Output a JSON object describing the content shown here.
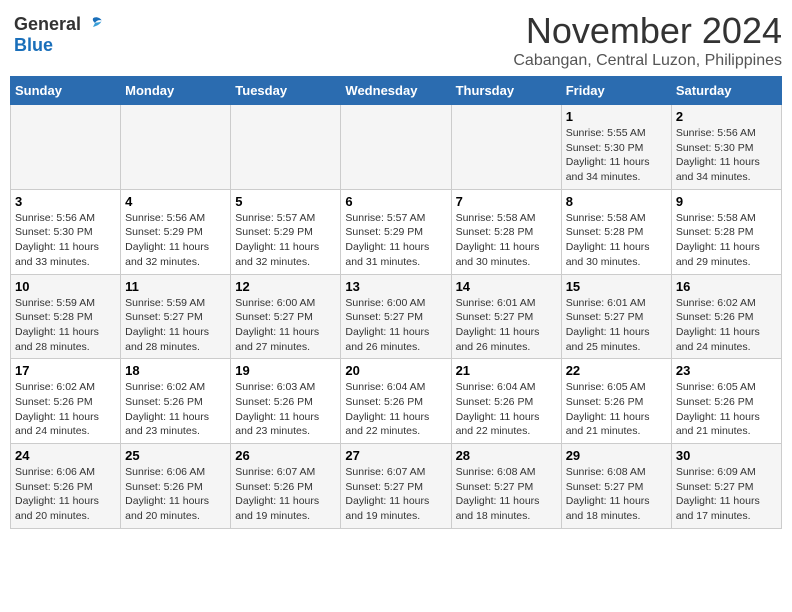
{
  "logo": {
    "general": "General",
    "blue": "Blue"
  },
  "title": "November 2024",
  "location": "Cabangan, Central Luzon, Philippines",
  "days_header": [
    "Sunday",
    "Monday",
    "Tuesday",
    "Wednesday",
    "Thursday",
    "Friday",
    "Saturday"
  ],
  "weeks": [
    [
      {
        "day": "",
        "info": ""
      },
      {
        "day": "",
        "info": ""
      },
      {
        "day": "",
        "info": ""
      },
      {
        "day": "",
        "info": ""
      },
      {
        "day": "",
        "info": ""
      },
      {
        "day": "1",
        "info": "Sunrise: 5:55 AM\nSunset: 5:30 PM\nDaylight: 11 hours and 34 minutes."
      },
      {
        "day": "2",
        "info": "Sunrise: 5:56 AM\nSunset: 5:30 PM\nDaylight: 11 hours and 34 minutes."
      }
    ],
    [
      {
        "day": "3",
        "info": "Sunrise: 5:56 AM\nSunset: 5:30 PM\nDaylight: 11 hours and 33 minutes."
      },
      {
        "day": "4",
        "info": "Sunrise: 5:56 AM\nSunset: 5:29 PM\nDaylight: 11 hours and 32 minutes."
      },
      {
        "day": "5",
        "info": "Sunrise: 5:57 AM\nSunset: 5:29 PM\nDaylight: 11 hours and 32 minutes."
      },
      {
        "day": "6",
        "info": "Sunrise: 5:57 AM\nSunset: 5:29 PM\nDaylight: 11 hours and 31 minutes."
      },
      {
        "day": "7",
        "info": "Sunrise: 5:58 AM\nSunset: 5:28 PM\nDaylight: 11 hours and 30 minutes."
      },
      {
        "day": "8",
        "info": "Sunrise: 5:58 AM\nSunset: 5:28 PM\nDaylight: 11 hours and 30 minutes."
      },
      {
        "day": "9",
        "info": "Sunrise: 5:58 AM\nSunset: 5:28 PM\nDaylight: 11 hours and 29 minutes."
      }
    ],
    [
      {
        "day": "10",
        "info": "Sunrise: 5:59 AM\nSunset: 5:28 PM\nDaylight: 11 hours and 28 minutes."
      },
      {
        "day": "11",
        "info": "Sunrise: 5:59 AM\nSunset: 5:27 PM\nDaylight: 11 hours and 28 minutes."
      },
      {
        "day": "12",
        "info": "Sunrise: 6:00 AM\nSunset: 5:27 PM\nDaylight: 11 hours and 27 minutes."
      },
      {
        "day": "13",
        "info": "Sunrise: 6:00 AM\nSunset: 5:27 PM\nDaylight: 11 hours and 26 minutes."
      },
      {
        "day": "14",
        "info": "Sunrise: 6:01 AM\nSunset: 5:27 PM\nDaylight: 11 hours and 26 minutes."
      },
      {
        "day": "15",
        "info": "Sunrise: 6:01 AM\nSunset: 5:27 PM\nDaylight: 11 hours and 25 minutes."
      },
      {
        "day": "16",
        "info": "Sunrise: 6:02 AM\nSunset: 5:26 PM\nDaylight: 11 hours and 24 minutes."
      }
    ],
    [
      {
        "day": "17",
        "info": "Sunrise: 6:02 AM\nSunset: 5:26 PM\nDaylight: 11 hours and 24 minutes."
      },
      {
        "day": "18",
        "info": "Sunrise: 6:02 AM\nSunset: 5:26 PM\nDaylight: 11 hours and 23 minutes."
      },
      {
        "day": "19",
        "info": "Sunrise: 6:03 AM\nSunset: 5:26 PM\nDaylight: 11 hours and 23 minutes."
      },
      {
        "day": "20",
        "info": "Sunrise: 6:04 AM\nSunset: 5:26 PM\nDaylight: 11 hours and 22 minutes."
      },
      {
        "day": "21",
        "info": "Sunrise: 6:04 AM\nSunset: 5:26 PM\nDaylight: 11 hours and 22 minutes."
      },
      {
        "day": "22",
        "info": "Sunrise: 6:05 AM\nSunset: 5:26 PM\nDaylight: 11 hours and 21 minutes."
      },
      {
        "day": "23",
        "info": "Sunrise: 6:05 AM\nSunset: 5:26 PM\nDaylight: 11 hours and 21 minutes."
      }
    ],
    [
      {
        "day": "24",
        "info": "Sunrise: 6:06 AM\nSunset: 5:26 PM\nDaylight: 11 hours and 20 minutes."
      },
      {
        "day": "25",
        "info": "Sunrise: 6:06 AM\nSunset: 5:26 PM\nDaylight: 11 hours and 20 minutes."
      },
      {
        "day": "26",
        "info": "Sunrise: 6:07 AM\nSunset: 5:26 PM\nDaylight: 11 hours and 19 minutes."
      },
      {
        "day": "27",
        "info": "Sunrise: 6:07 AM\nSunset: 5:27 PM\nDaylight: 11 hours and 19 minutes."
      },
      {
        "day": "28",
        "info": "Sunrise: 6:08 AM\nSunset: 5:27 PM\nDaylight: 11 hours and 18 minutes."
      },
      {
        "day": "29",
        "info": "Sunrise: 6:08 AM\nSunset: 5:27 PM\nDaylight: 11 hours and 18 minutes."
      },
      {
        "day": "30",
        "info": "Sunrise: 6:09 AM\nSunset: 5:27 PM\nDaylight: 11 hours and 17 minutes."
      }
    ]
  ]
}
